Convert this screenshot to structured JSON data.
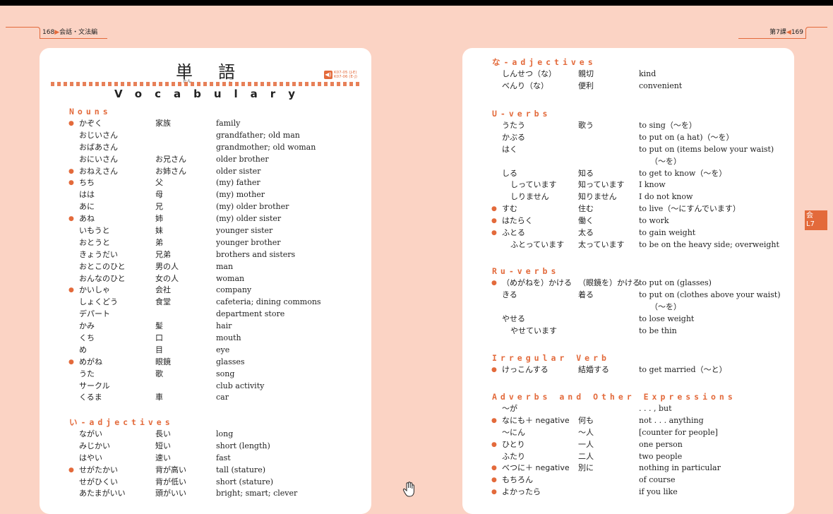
{
  "header": {
    "left_page_no": "168",
    "left_title": "会話・文法編",
    "right_lesson": "第7課",
    "right_page_no": "169"
  },
  "title": {
    "jp": "単語",
    "furigana": [
      "たん",
      "ご"
    ],
    "en": "Vocabulary",
    "audio": [
      "K07-05 (J-E)",
      "K07-06 (E-J)"
    ]
  },
  "side_tab": [
    "会",
    "L7"
  ],
  "left_sections": [
    {
      "title": "Nouns",
      "items": [
        {
          "star": true,
          "kana": "かぞく",
          "kanji": "家族",
          "eng": "family"
        },
        {
          "star": false,
          "kana": "おじいさん",
          "kanji": "",
          "eng": "grandfather; old man"
        },
        {
          "star": false,
          "kana": "おばあさん",
          "kanji": "",
          "eng": "grandmother; old woman"
        },
        {
          "star": false,
          "kana": "おにいさん",
          "kanji": "お兄さん",
          "eng": "older brother"
        },
        {
          "star": true,
          "kana": "おねえさん",
          "kanji": "お姉さん",
          "eng": "older sister"
        },
        {
          "star": true,
          "kana": "ちち",
          "kanji": "父",
          "eng": "(my) father"
        },
        {
          "star": false,
          "kana": "はは",
          "kanji": "母",
          "eng": "(my) mother"
        },
        {
          "star": false,
          "kana": "あに",
          "kanji": "兄",
          "eng": "(my) older brother"
        },
        {
          "star": true,
          "kana": "あね",
          "kanji": "姉",
          "eng": "(my) older sister"
        },
        {
          "star": false,
          "kana": "いもうと",
          "kanji": "妹",
          "eng": "younger sister"
        },
        {
          "star": false,
          "kana": "おとうと",
          "kanji": "弟",
          "eng": "younger brother"
        },
        {
          "star": false,
          "kana": "きょうだい",
          "kanji": "兄弟",
          "eng": "brothers and sisters"
        },
        {
          "star": false,
          "kana": "おとこのひと",
          "kanji": "男の人",
          "eng": "man"
        },
        {
          "star": false,
          "kana": "おんなのひと",
          "kanji": "女の人",
          "eng": "woman"
        },
        {
          "star": true,
          "kana": "かいしゃ",
          "kanji": "会社",
          "eng": "company"
        },
        {
          "star": false,
          "kana": "しょくどう",
          "kanji": "食堂",
          "eng": "cafeteria; dining commons"
        },
        {
          "star": false,
          "kana": "デパート",
          "kanji": "",
          "eng": "department store"
        },
        {
          "star": false,
          "kana": "かみ",
          "kanji": "髪",
          "eng": "hair"
        },
        {
          "star": false,
          "kana": "くち",
          "kanji": "口",
          "eng": "mouth"
        },
        {
          "star": false,
          "kana": "め",
          "kanji": "目",
          "eng": "eye"
        },
        {
          "star": true,
          "kana": "めがね",
          "kanji": "眼鏡",
          "eng": "glasses"
        },
        {
          "star": false,
          "kana": "うた",
          "kanji": "歌",
          "eng": "song"
        },
        {
          "star": false,
          "kana": "サークル",
          "kanji": "",
          "eng": "club activity"
        },
        {
          "star": false,
          "kana": "くるま",
          "kanji": "車",
          "eng": "car"
        }
      ]
    },
    {
      "title": "い-adjectives",
      "items": [
        {
          "star": false,
          "kana": "ながい",
          "kanji": "長い",
          "eng": "long"
        },
        {
          "star": false,
          "kana": "みじかい",
          "kanji": "短い",
          "eng": "short (length)"
        },
        {
          "star": false,
          "kana": "はやい",
          "kanji": "速い",
          "eng": "fast"
        },
        {
          "star": true,
          "kana": "せがたかい",
          "kanji": "背が高い",
          "eng": "tall (stature)"
        },
        {
          "star": false,
          "kana": "せがひくい",
          "kanji": "背が低い",
          "eng": "short (stature)"
        },
        {
          "star": false,
          "kana": "あたまがいい",
          "kanji": "頭がいい",
          "eng": "bright; smart; clever"
        }
      ]
    }
  ],
  "right_sections": [
    {
      "title": "な-adjectives",
      "items": [
        {
          "star": false,
          "kana": "しんせつ（な）",
          "kanji": "親切",
          "eng": "kind"
        },
        {
          "star": false,
          "kana": "べんり（な）",
          "kanji": "便利",
          "eng": "convenient"
        }
      ]
    },
    {
      "title": "U-verbs",
      "items": [
        {
          "star": false,
          "kana": "うたう",
          "kanji": "歌う",
          "eng": "to sing（～を）"
        },
        {
          "star": false,
          "kana": "かぶる",
          "kanji": "",
          "eng": "to put on (a hat)（～を）"
        },
        {
          "star": false,
          "kana": "はく",
          "kanji": "",
          "eng": "to put on (items below your waist)"
        },
        {
          "star": false,
          "kana": "",
          "kanji": "",
          "eng": "（～を）",
          "cont": true
        },
        {
          "star": false,
          "kana": "しる",
          "kanji": "知る",
          "eng": "to get to know（～を）"
        },
        {
          "star": false,
          "kana": "しっています",
          "kanji": "知っています",
          "eng": "I know",
          "indent": true
        },
        {
          "star": false,
          "kana": "しりません",
          "kanji": "知りません",
          "eng": "I do not know",
          "indent": true
        },
        {
          "star": true,
          "kana": "すむ",
          "kanji": "住む",
          "eng": "to live（～にすんでいます）"
        },
        {
          "star": true,
          "kana": "はたらく",
          "kanji": "働く",
          "eng": "to work"
        },
        {
          "star": true,
          "kana": "ふとる",
          "kanji": "太る",
          "eng": "to gain weight"
        },
        {
          "star": false,
          "kana": "ふとっています",
          "kanji": "太っています",
          "eng": "to be on the heavy side; overweight",
          "indent": true
        }
      ]
    },
    {
      "title": "Ru-verbs",
      "items": [
        {
          "star": true,
          "kana": "（めがねを）かける",
          "kanji": "（眼鏡を）かける",
          "eng": "to put on (glasses)"
        },
        {
          "star": false,
          "kana": "きる",
          "kanji": "着る",
          "eng": "to put on (clothes above your waist)"
        },
        {
          "star": false,
          "kana": "",
          "kanji": "",
          "eng": "（～を）",
          "cont": true
        },
        {
          "star": false,
          "kana": "やせる",
          "kanji": "",
          "eng": "to lose weight"
        },
        {
          "star": false,
          "kana": "やせています",
          "kanji": "",
          "eng": "to be thin",
          "indent": true
        }
      ]
    },
    {
      "title": "Irregular Verb",
      "items": [
        {
          "star": true,
          "kana": "けっこんする",
          "kanji": "結婚する",
          "eng": "to get married（～と）"
        }
      ]
    },
    {
      "title": "Adverbs and Other Expressions",
      "items": [
        {
          "star": false,
          "kana": "～が",
          "kanji": "",
          "eng": ". . . , but"
        },
        {
          "star": true,
          "kana": "なにも＋ negative",
          "kanji": "何も",
          "eng": "not . . . anything"
        },
        {
          "star": false,
          "kana": "～にん",
          "kanji": "～人",
          "eng": "[counter for people]"
        },
        {
          "star": true,
          "kana": "ひとり",
          "kanji": "一人",
          "eng": "one person"
        },
        {
          "star": false,
          "kana": "ふたり",
          "kanji": "二人",
          "eng": "two people"
        },
        {
          "star": true,
          "kana": "べつに＋ negative",
          "kanji": "別に",
          "eng": "nothing in particular"
        },
        {
          "star": true,
          "kana": "もちろん",
          "kanji": "",
          "eng": "of course"
        },
        {
          "star": true,
          "kana": "よかったら",
          "kanji": "",
          "eng": "if you like"
        }
      ]
    }
  ],
  "colors": {
    "accent": "#e36a3b",
    "background": "#fbd3c4",
    "page": "#ffffff"
  }
}
